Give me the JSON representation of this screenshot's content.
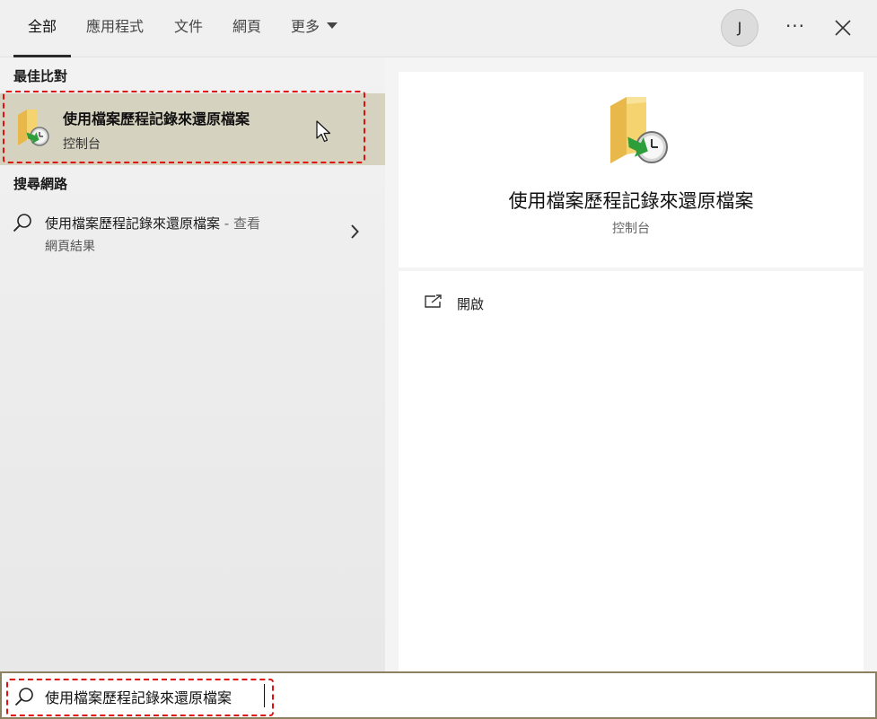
{
  "tabs": [
    {
      "label": "全部",
      "active": true
    },
    {
      "label": "應用程式"
    },
    {
      "label": "文件"
    },
    {
      "label": "網頁"
    },
    {
      "label": "更多"
    }
  ],
  "header": {
    "avatar_initial": "J",
    "more_label": "···"
  },
  "best_match": {
    "section_title": "最佳比對",
    "title": "使用檔案歷程記錄來還原檔案",
    "subtitle": "控制台"
  },
  "web_search": {
    "section_title": "搜尋網路",
    "title": "使用檔案歷程記錄來還原檔案",
    "suffix": " - 查看",
    "subtitle": "網頁結果"
  },
  "detail": {
    "title": "使用檔案歷程記錄來還原檔案",
    "subtitle": "控制台",
    "actions": [
      {
        "label": "開啟",
        "icon": "open-icon"
      }
    ]
  },
  "search": {
    "value": "使用檔案歷程記錄來還原檔案",
    "placeholder": ""
  },
  "colors": {
    "highlight_bg": "#d6d2c0",
    "annotation_red": "#e01010",
    "search_border": "#8c8260",
    "folder_yellow": "#f5d36e",
    "restore_green": "#2e9e3a"
  }
}
